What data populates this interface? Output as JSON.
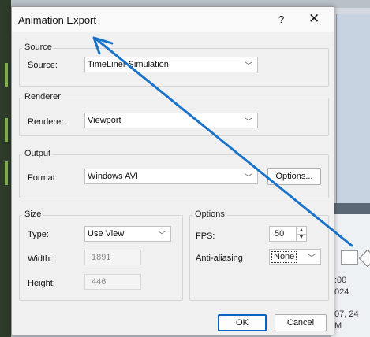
{
  "window": {
    "title": "Animation Export",
    "help_glyph": "?",
    "close_glyph": "✕"
  },
  "source": {
    "group_label": "Source",
    "source_label": "Source:",
    "source_value": "TimeLiner Simulation"
  },
  "renderer": {
    "group_label": "Renderer",
    "renderer_label": "Renderer:",
    "renderer_value": "Viewport"
  },
  "output": {
    "group_label": "Output",
    "format_label": "Format:",
    "format_value": "Windows AVI",
    "options_button": "Options..."
  },
  "size": {
    "group_label": "Size",
    "type_label": "Type:",
    "type_value": "Use View",
    "width_label": "Width:",
    "width_value": "1891",
    "height_label": "Height:",
    "height_value": "446"
  },
  "options": {
    "group_label": "Options",
    "fps_label": "FPS:",
    "fps_value": "50",
    "aa_label": "Anti-aliasing",
    "aa_value": "None"
  },
  "buttons": {
    "ok": "OK",
    "cancel": "Cancel"
  },
  "background": {
    "text_1": ":00",
    "text_2": "024",
    "text_3": "07, 24",
    "text_4": "M"
  },
  "icons": {
    "dropdown": "chevron-down-icon",
    "annotation": "blue-arrow-annotation"
  },
  "colors": {
    "annotation_arrow": "#1a73c8"
  }
}
